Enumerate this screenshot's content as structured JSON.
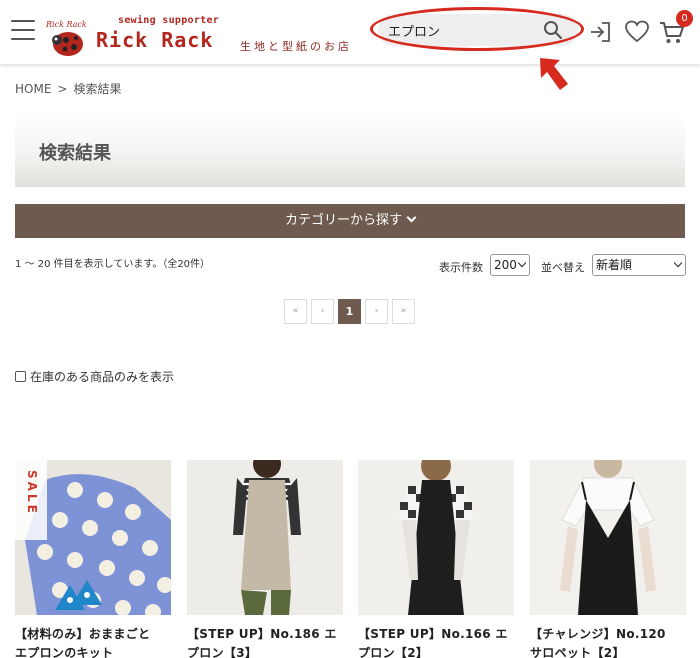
{
  "header": {
    "tagline": "sewing supporter",
    "brand": "Rick Rack",
    "subtitle": "生地と型紙のお店",
    "logo_script": "Rick Rack",
    "search": {
      "value": "エプロン",
      "placeholder": ""
    },
    "cart_count": "0",
    "icons": [
      "menu-icon",
      "search-icon",
      "login-icon",
      "heart-icon",
      "cart-icon"
    ]
  },
  "breadcrumb": {
    "home": "HOME",
    "separator": ">",
    "current": "検索結果"
  },
  "page_title": "検索結果",
  "category_button": "カテゴリーから探す",
  "result_count": "1 〜 20 件目を表示しています。（全20件）",
  "controls": {
    "per_page_label": "表示件数",
    "per_page_value": "200",
    "sort_label": "並べ替え",
    "sort_value": "新着順"
  },
  "pagination": {
    "first": "«",
    "prev": "‹",
    "current": "1",
    "next": "›",
    "last": "»"
  },
  "stock_filter": "在庫のある商品のみを表示",
  "products": [
    {
      "line1": "【材料のみ】おままごと",
      "line2": "エプロンのキット",
      "badge": "SALE"
    },
    {
      "line1": "【STEP UP】No.186 エ",
      "line2": "プロン【3】"
    },
    {
      "line1": "【STEP UP】No.166 エ",
      "line2": "プロン【2】"
    },
    {
      "line1": "【チャレンジ】No.120",
      "line2": "サロペット【2】"
    }
  ],
  "colors": {
    "brand_red": "#b3261e",
    "category_bar": "#6e5a4e",
    "highlight": "#d62a1f"
  }
}
